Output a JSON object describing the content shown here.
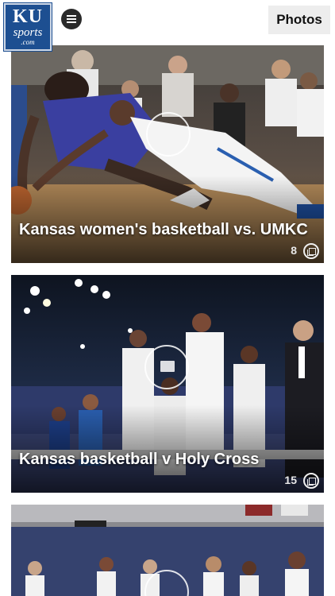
{
  "header": {
    "logo_line1": "KU",
    "logo_line2": "sports",
    "logo_line3": ".com",
    "photos_label": "Photos"
  },
  "galleries": [
    {
      "title": "Kansas women's basketball vs. UMKC",
      "count": "8"
    },
    {
      "title": "Kansas basketball v Holy Cross",
      "count": "15"
    },
    {
      "title": "",
      "count": ""
    }
  ],
  "colors": {
    "brand_blue": "#1d4f91",
    "header_bg": "#ffffff",
    "button_bg": "#ededed"
  }
}
